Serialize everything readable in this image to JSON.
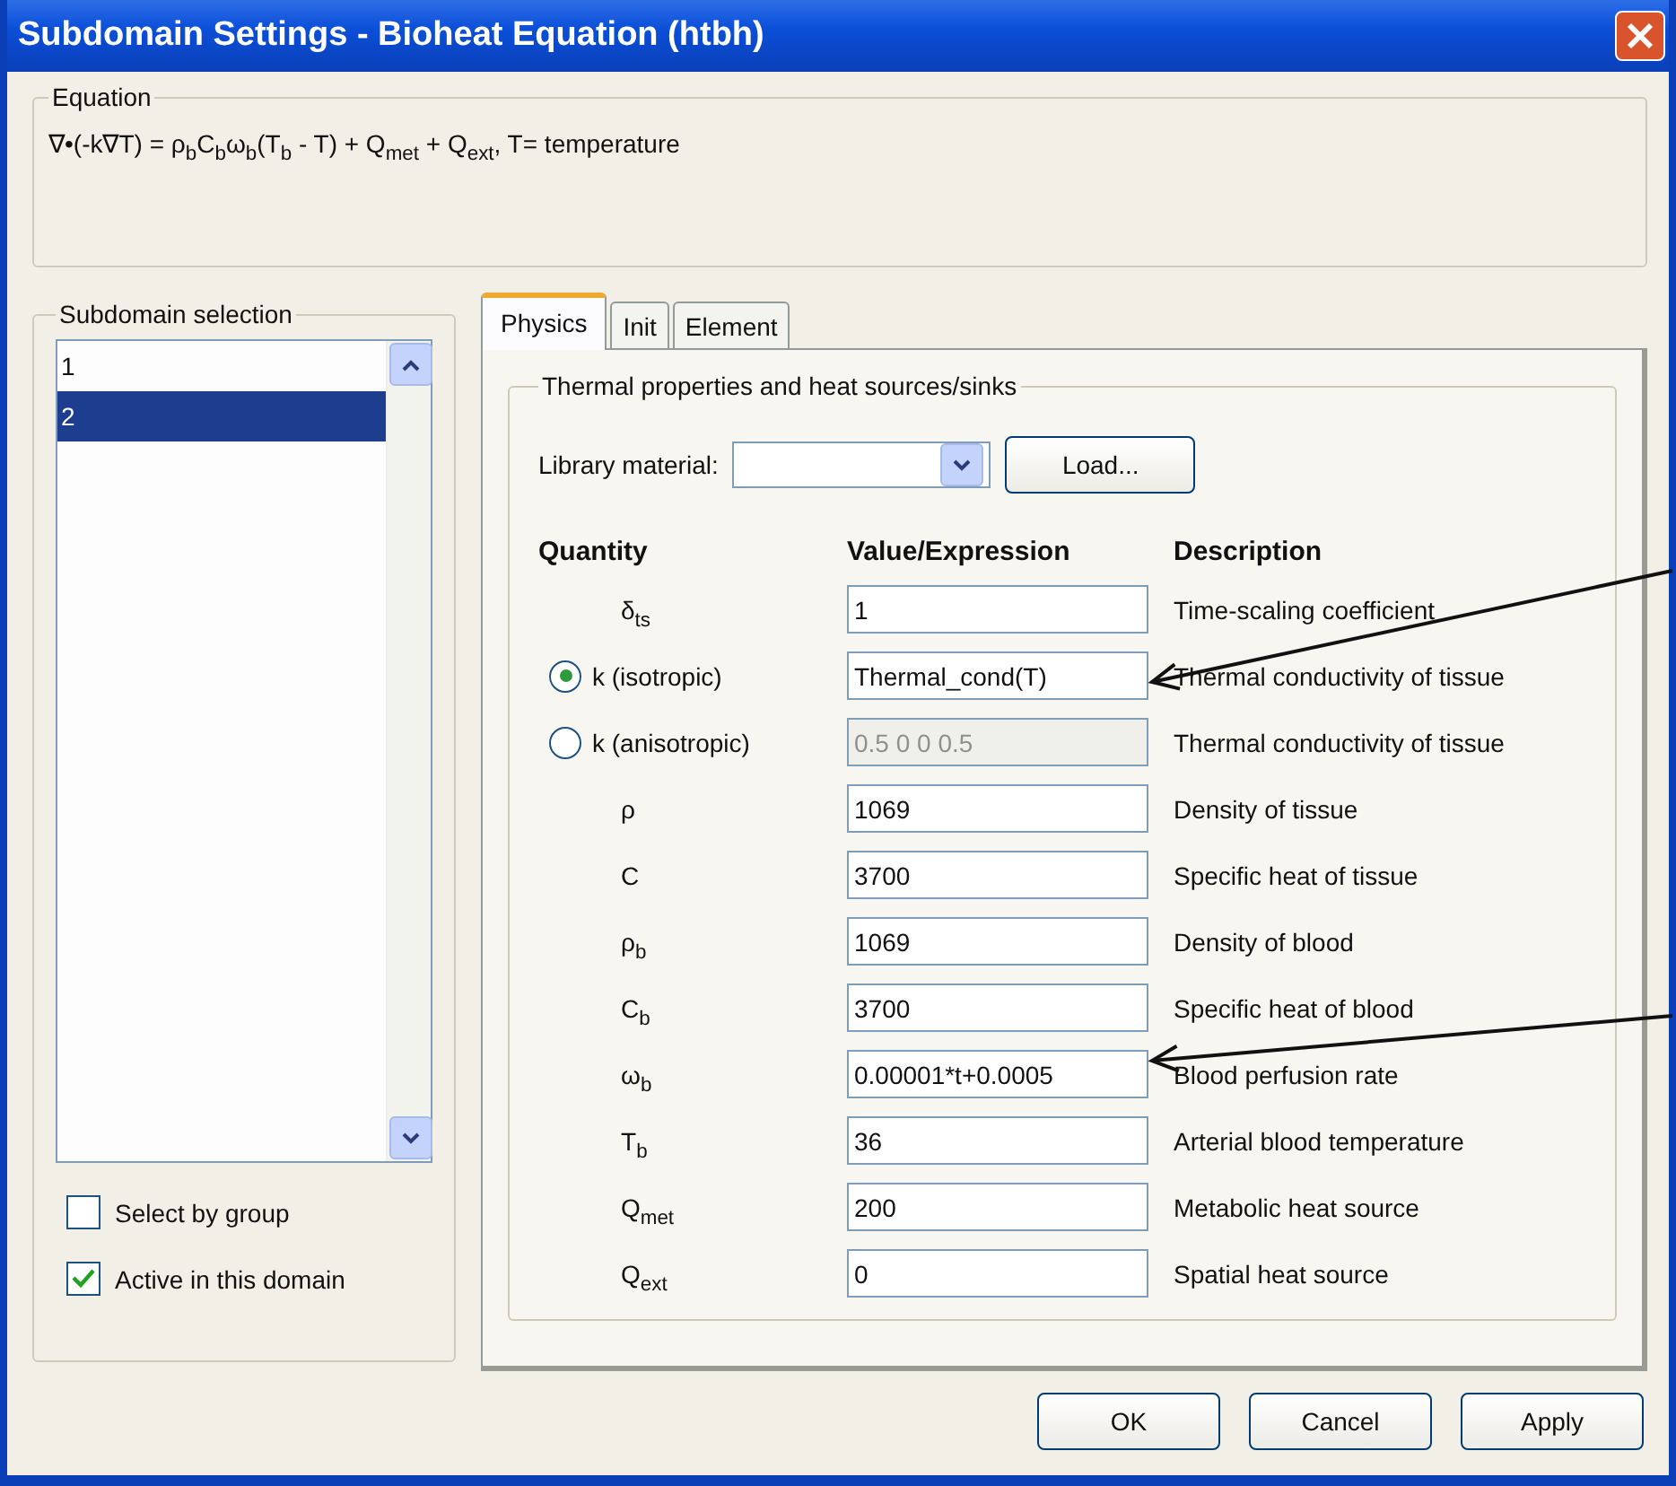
{
  "window": {
    "title": "Subdomain Settings - Bioheat Equation (htbh)"
  },
  "equation": {
    "legend": "Equation",
    "text": "∇•(-k∇T) = ρ$_{b}$C$_{b}$ω$_{b}$(T$_{b}$ - T) + Q$_{met}$ + Q$_{ext}$, T= temperature"
  },
  "subdomain_selection": {
    "legend": "Subdomain selection",
    "items": [
      {
        "label": "1",
        "selected": false
      },
      {
        "label": "2",
        "selected": true
      }
    ],
    "checkboxes": [
      {
        "label": "Select by group",
        "checked": false
      },
      {
        "label": "Active in this domain",
        "checked": true
      }
    ]
  },
  "tabs": [
    {
      "label": "Physics",
      "selected": true
    },
    {
      "label": "Init",
      "selected": false
    },
    {
      "label": "Element",
      "selected": false
    }
  ],
  "physics": {
    "legend": "Thermal properties and heat sources/sinks",
    "library_material": {
      "label": "Library material:"
    },
    "load_button": "Load...",
    "columns": [
      "Quantity",
      "Value/Expression",
      "Description"
    ],
    "rows": [
      {
        "kind": "plain",
        "quantity": "δ$_{ts}$",
        "value": "1",
        "description": "Time-scaling coefficient",
        "disabled": false
      },
      {
        "kind": "radio",
        "quantity": "k (isotropic)",
        "selected": true,
        "value": "Thermal_cond(T)",
        "description": "Thermal conductivity of tissue",
        "disabled": false
      },
      {
        "kind": "radio",
        "quantity": "k (anisotropic)",
        "selected": false,
        "value": "0.5 0 0 0.5",
        "description": "Thermal conductivity of tissue",
        "disabled": true
      },
      {
        "kind": "plain",
        "quantity": "ρ",
        "value": "1069",
        "description": "Density of tissue",
        "disabled": false
      },
      {
        "kind": "plain",
        "quantity": "C",
        "value": "3700",
        "description": "Specific heat of tissue",
        "disabled": false
      },
      {
        "kind": "plain",
        "quantity": "ρ$_{b}$",
        "value": "1069",
        "description": "Density of blood",
        "disabled": false
      },
      {
        "kind": "plain",
        "quantity": "C$_{b}$",
        "value": "3700",
        "description": "Specific heat of blood",
        "disabled": false
      },
      {
        "kind": "plain",
        "quantity": "ω$_{b}$",
        "value": "0.00001*t+0.0005",
        "description": "Blood perfusion rate",
        "disabled": false
      },
      {
        "kind": "plain",
        "quantity": "T$_{b}$",
        "value": "36",
        "description": "Arterial blood temperature",
        "disabled": false
      },
      {
        "kind": "plain",
        "quantity": "Q$_{met}$",
        "value": "200",
        "description": "Metabolic heat source",
        "disabled": false
      },
      {
        "kind": "plain",
        "quantity": "Q$_{ext}$",
        "value": "0",
        "description": "Spatial heat source",
        "disabled": false
      }
    ]
  },
  "buttons": [
    "OK",
    "Cancel",
    "Apply"
  ]
}
